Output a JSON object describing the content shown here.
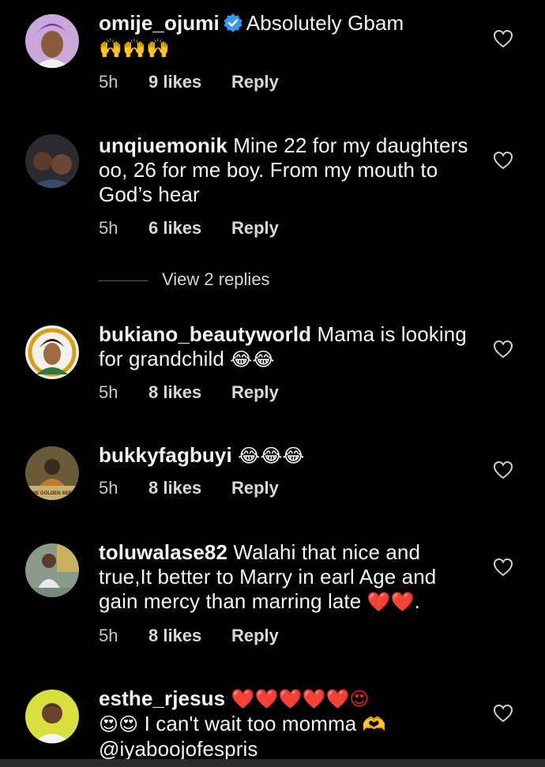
{
  "comments": [
    {
      "username": "omije_ojumi",
      "verified": true,
      "text": "Absolutely Gbam",
      "emojis": "🙌🙌🙌",
      "time": "5h",
      "likes": "9 likes",
      "reply": "Reply"
    },
    {
      "username": "unqiuemonik",
      "text": "Mine 22 for my daughters oo, 26 for me boy. From my mouth to God’s hear",
      "time": "5h",
      "likes": "6 likes",
      "reply": "Reply"
    },
    {
      "username": "bukiano_beautyworld",
      "text": "Mama is looking for grandchild",
      "emojis": "😂😂",
      "time": "5h",
      "likes": "8 likes",
      "reply": "Reply"
    },
    {
      "username": "bukkyfagbuyi",
      "text": "",
      "emojis": "😂😂😂",
      "time": "5h",
      "likes": "8 likes",
      "reply": "Reply"
    },
    {
      "username": "toluwalase82",
      "text": "Walahi that nice and true,It better to Marry in earl Age and gain mercy than marring late",
      "emojis": "❤️❤️",
      "text_after": ".",
      "time": "5h",
      "likes": "8 likes",
      "reply": "Reply"
    },
    {
      "username": "esthe_rjesus",
      "emojis": "❤️❤️❤️❤️❤️😍",
      "emojis2": "😍😍",
      "text": "I can't wait too momma",
      "text_tail": "🫶",
      "mention": "@iyaboojofespris"
    }
  ],
  "view_replies": "View 2 replies",
  "avatar_caption": "THE GOLDEN SEED",
  "colors": {
    "background": "#000000",
    "text": "#f5f5f5",
    "meta": "#c8c8c8",
    "verified": "#3897f0"
  }
}
